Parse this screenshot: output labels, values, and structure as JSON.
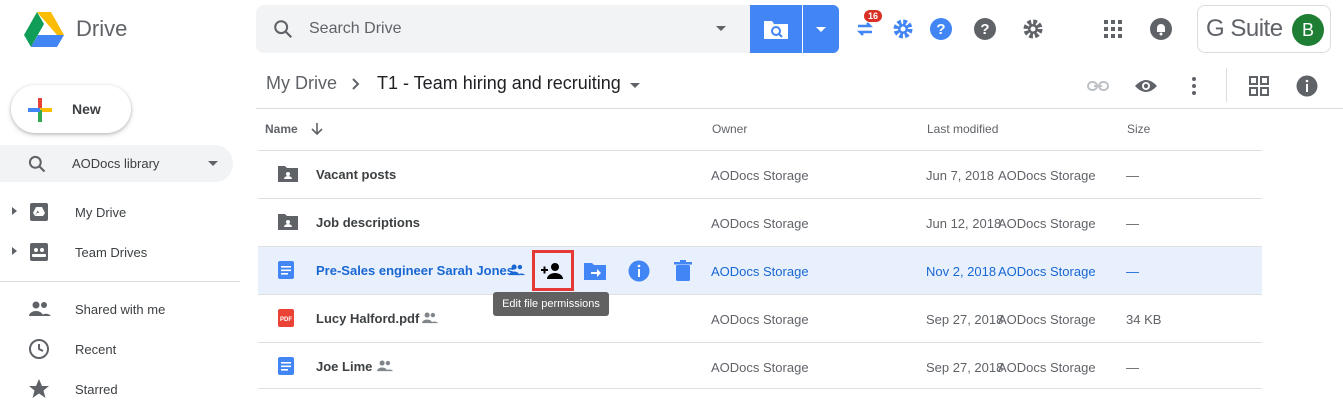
{
  "app": {
    "name": "Drive"
  },
  "search": {
    "placeholder": "Search Drive"
  },
  "header": {
    "sync_badge": "16",
    "gsuite_label": "G Suite",
    "avatar_initial": "B"
  },
  "sidebar": {
    "new_label": "New",
    "library_label": "AODocs library",
    "items": [
      {
        "label": "My Drive",
        "icon": "my-drive-icon"
      },
      {
        "label": "Team Drives",
        "icon": "team-drives-icon"
      },
      {
        "label": "Shared with me",
        "icon": "people-icon"
      },
      {
        "label": "Recent",
        "icon": "clock-icon"
      },
      {
        "label": "Starred",
        "icon": "star-icon"
      }
    ]
  },
  "breadcrumb": {
    "root": "My Drive",
    "current": "T1 - Team hiring and recruiting"
  },
  "columns": {
    "name": "Name",
    "owner": "Owner",
    "modified": "Last modified",
    "size": "Size"
  },
  "files": [
    {
      "name": "Vacant posts",
      "type": "shared-folder",
      "owner": "AODocs Storage",
      "date": "Jun 7, 2018",
      "modified_by": "AODocs Storage",
      "size": "—",
      "shared": false
    },
    {
      "name": "Job descriptions",
      "type": "shared-folder",
      "owner": "AODocs Storage",
      "date": "Jun 12, 2018",
      "modified_by": "AODocs Storage",
      "size": "—",
      "shared": false
    },
    {
      "name": "Pre-Sales engineer Sarah Jones",
      "type": "doc",
      "owner": "AODocs Storage",
      "date": "Nov 2, 2018",
      "modified_by": "AODocs Storage",
      "size": "—",
      "shared": true,
      "selected": true
    },
    {
      "name": "Lucy Halford.pdf",
      "type": "pdf",
      "owner": "AODocs Storage",
      "date": "Sep 27, 2018",
      "modified_by": "AODocs Storage",
      "size": "34 KB",
      "shared": true
    },
    {
      "name": "Joe Lime",
      "type": "doc",
      "owner": "AODocs Storage",
      "date": "Sep 27, 2018",
      "modified_by": "AODocs Storage",
      "size": "—",
      "shared": true
    }
  ],
  "pdf_icon_label": "PDF",
  "tooltip": "Edit file permissions",
  "colors": {
    "accent": "#4285f4",
    "selected_bg": "#e8f0fe",
    "selected_text": "#1967d2",
    "highlight": "#e53935"
  }
}
